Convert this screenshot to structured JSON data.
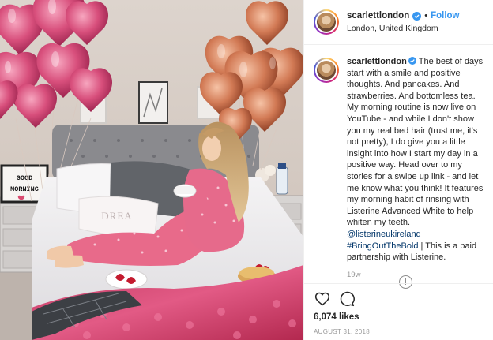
{
  "post": {
    "username": "scarlettlondon",
    "follow_label": "Follow",
    "dot": "•",
    "location": "London, United Kingdom",
    "caption": {
      "text_1": "The best of days start with a smile and positive thoughts. And pancakes. And strawberries. And bottomless tea. My morning routine is now live on YouTube - and while I don't show you my real bed hair (trust me, it's not pretty), I do give you a little insight into how I start my day in a positive way. Head over to my stories for a swipe up link - and let me know what you think! It features my morning habit of rinsing with Listerine Advanced White to help whiten my teeth. ",
      "mention": "@listerineukireland",
      "hashtag": "#BringOutTheBold",
      "text_2": " | This is a paid partnership with Listerine."
    },
    "age": "19w",
    "likes": "6,074 likes",
    "date": "AUGUST 31, 2018"
  },
  "photo": {
    "lightbox_text": "GOOD MORNING",
    "pillow_text": "DREA"
  },
  "icons": {
    "verified": "verified-badge-icon",
    "like": "heart-icon",
    "comment": "comment-bubble-icon",
    "more": "more-options-icon"
  },
  "colors": {
    "accent": "#3897f0",
    "text": "#262626",
    "muted": "#999999",
    "link": "#003569"
  }
}
